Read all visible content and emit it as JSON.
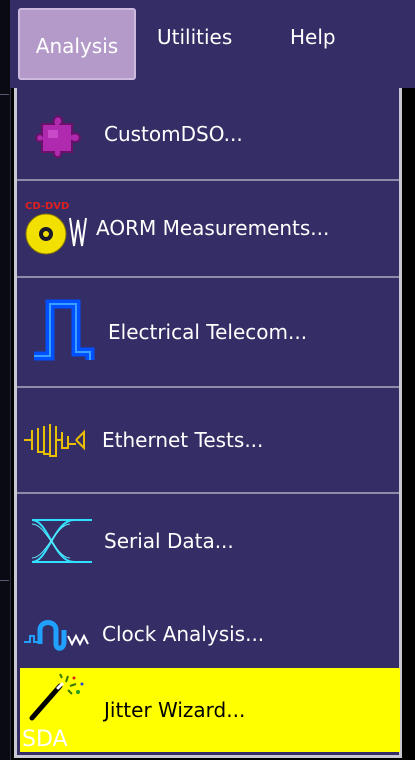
{
  "menubar": {
    "items": [
      {
        "label": "Analysis",
        "active": true
      },
      {
        "label": "Utilities"
      },
      {
        "label": "Help"
      }
    ]
  },
  "dropdown": {
    "items": [
      {
        "label": "CustomDSO...",
        "icon": "puzzle-icon"
      },
      {
        "label": "AORM Measurements...",
        "icon": "cd-dvd-icon",
        "icon_text": "CD-DVD"
      },
      {
        "label": "Electrical Telecom...",
        "icon": "pulse-icon"
      },
      {
        "label": "Ethernet Tests...",
        "icon": "ethernet-waveform-icon"
      },
      {
        "label": "Serial Data...",
        "icon": "eye-diagram-icon"
      },
      {
        "label": "Clock Analysis...",
        "icon": "clock-waveform-icon"
      },
      {
        "label": "Jitter Wizard...",
        "icon": "wand-icon",
        "icon_text": "SDA",
        "highlighted": true
      }
    ]
  },
  "colors": {
    "menu_bg": "#352d65",
    "active_title_bg": "#b49ac8",
    "highlight_bg": "#ffff00",
    "border": "#c8c8d2"
  }
}
